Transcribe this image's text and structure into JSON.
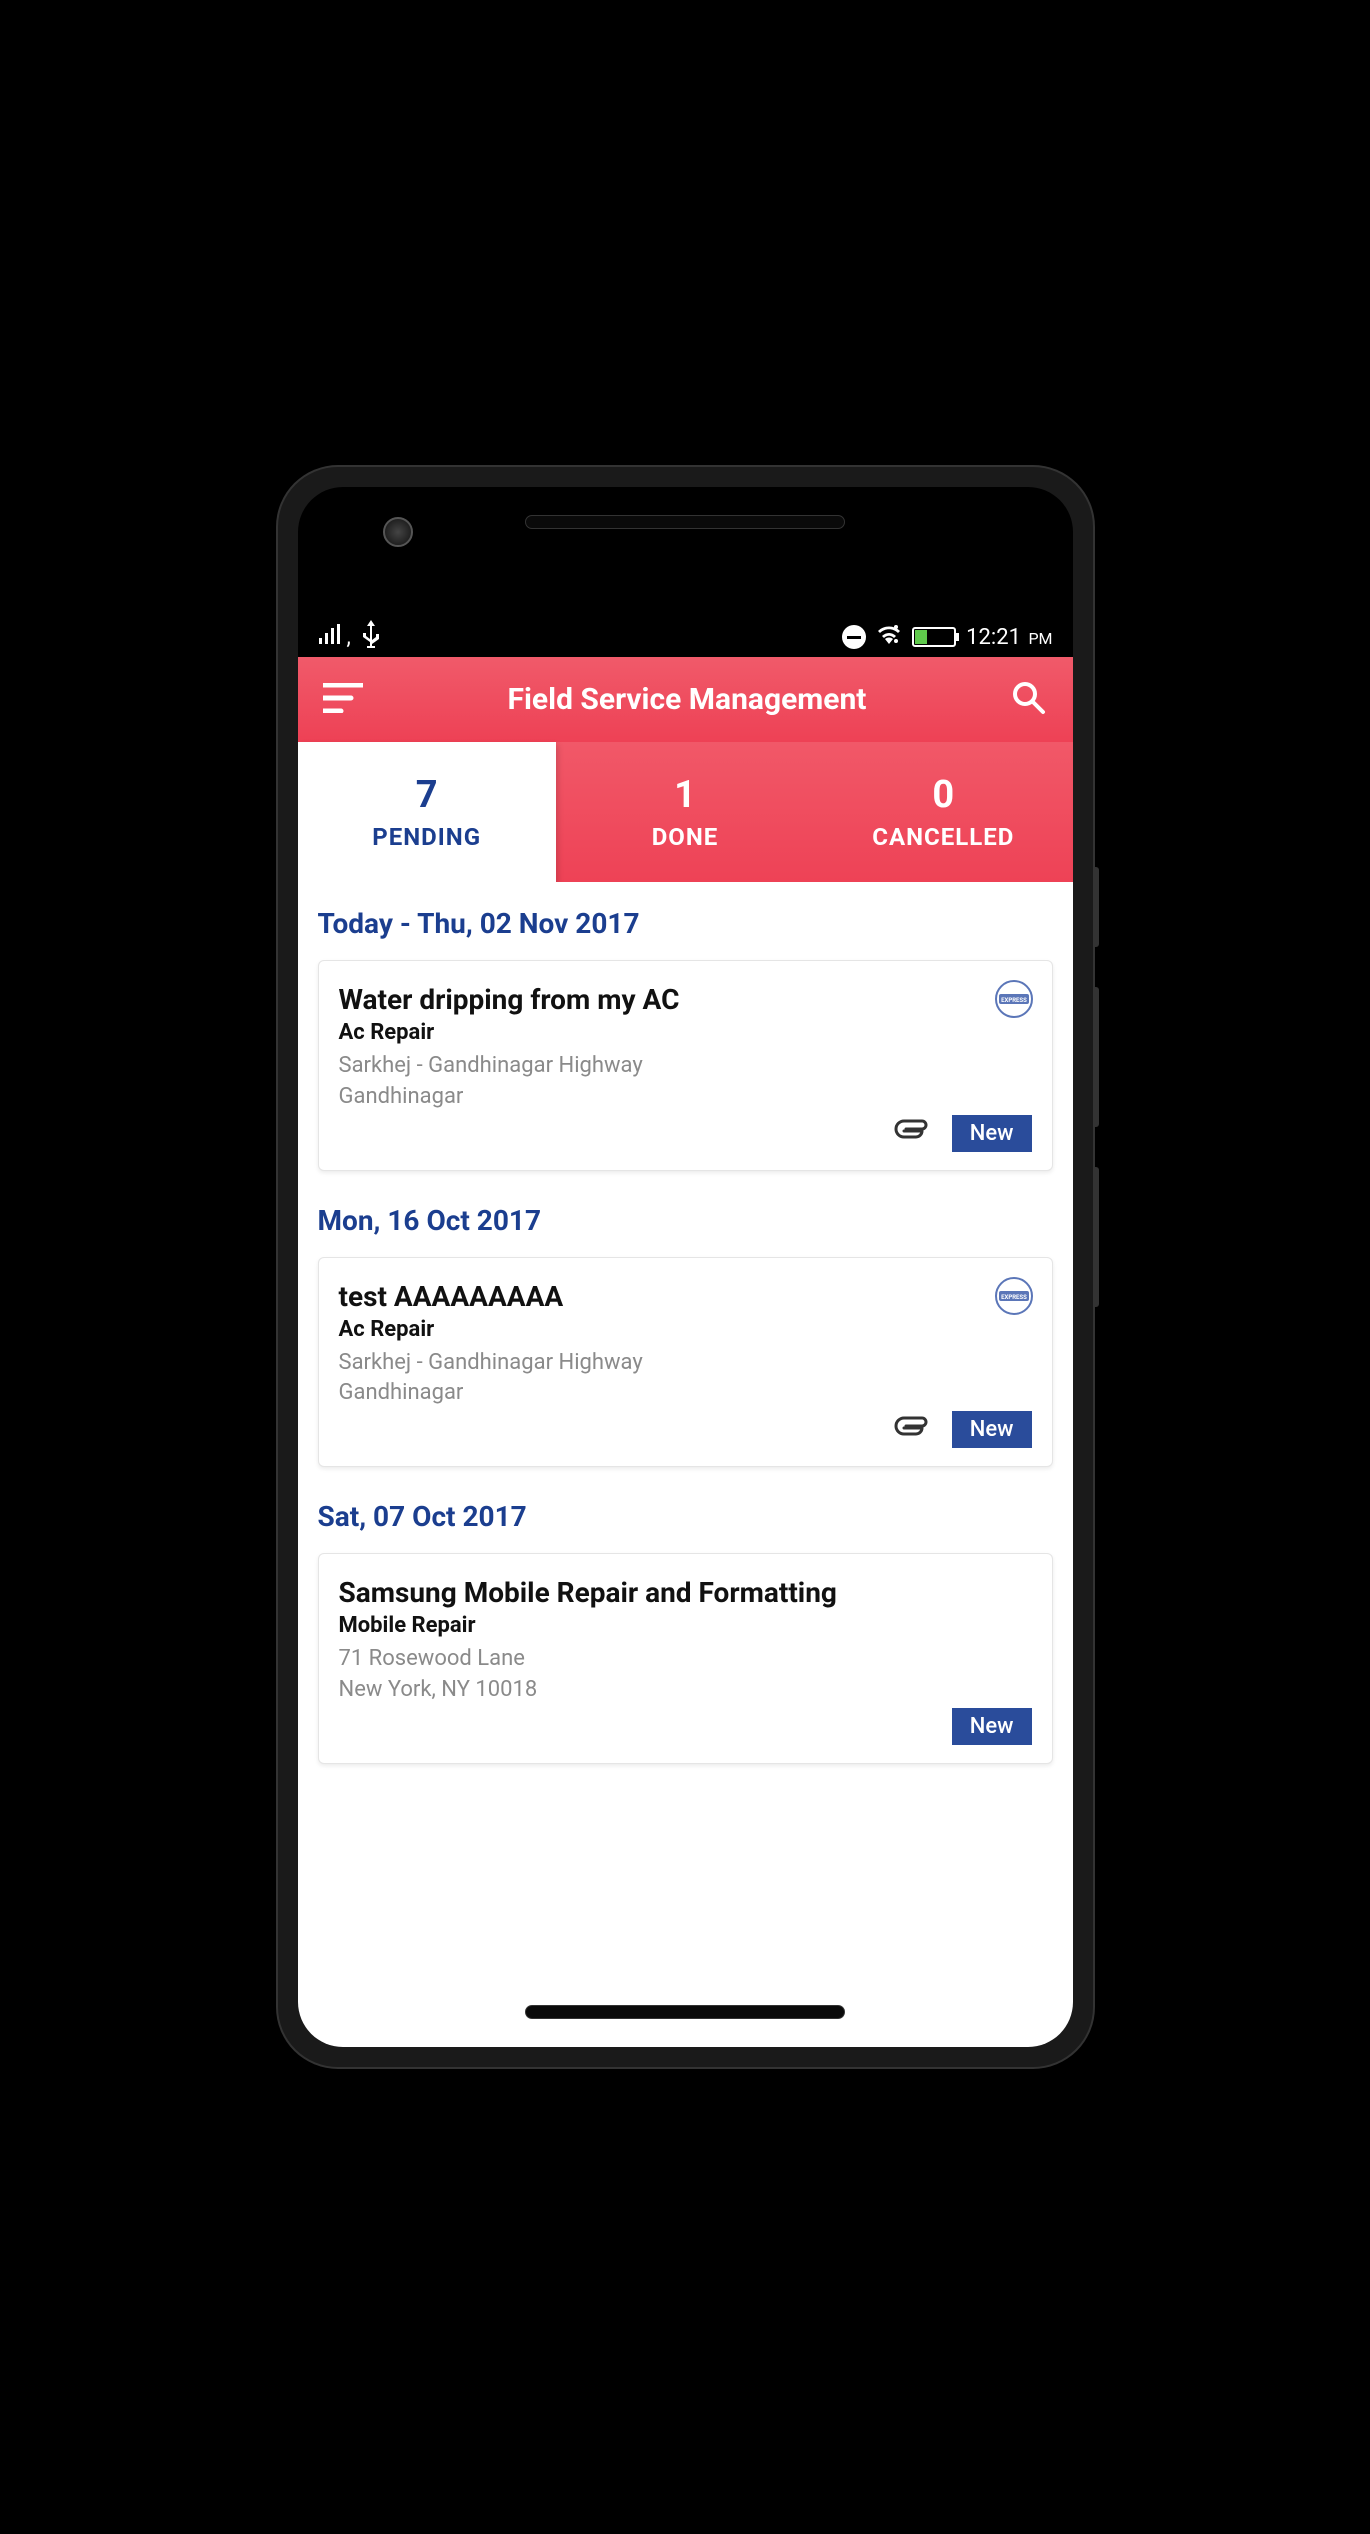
{
  "status_bar": {
    "time": "12:21",
    "period": "PM"
  },
  "header": {
    "title": "Field Service Management"
  },
  "tabs": [
    {
      "count": "7",
      "label": "PENDING",
      "active": true
    },
    {
      "count": "1",
      "label": "DONE",
      "active": false
    },
    {
      "count": "0",
      "label": "CANCELLED",
      "active": false
    }
  ],
  "sections": [
    {
      "date": "Today - Thu, 02 Nov 2017",
      "cards": [
        {
          "title": "Water dripping from my AC",
          "category": "Ac Repair",
          "address1": "Sarkhej - Gandhinagar Highway",
          "address2": "Gandhinagar",
          "has_attachment": true,
          "has_express": true,
          "status": "New"
        }
      ]
    },
    {
      "date": "Mon, 16 Oct 2017",
      "cards": [
        {
          "title": "test AAAAAAAAA",
          "category": "Ac Repair",
          "address1": "Sarkhej - Gandhinagar Highway",
          "address2": "Gandhinagar",
          "has_attachment": true,
          "has_express": true,
          "status": "New"
        }
      ]
    },
    {
      "date": "Sat, 07 Oct 2017",
      "cards": [
        {
          "title": "Samsung Mobile Repair and Formatting",
          "category": "Mobile Repair",
          "address1": "71 Rosewood Lane",
          "address2": "New York, NY 10018",
          "has_attachment": false,
          "has_express": false,
          "status": "New"
        }
      ]
    }
  ]
}
